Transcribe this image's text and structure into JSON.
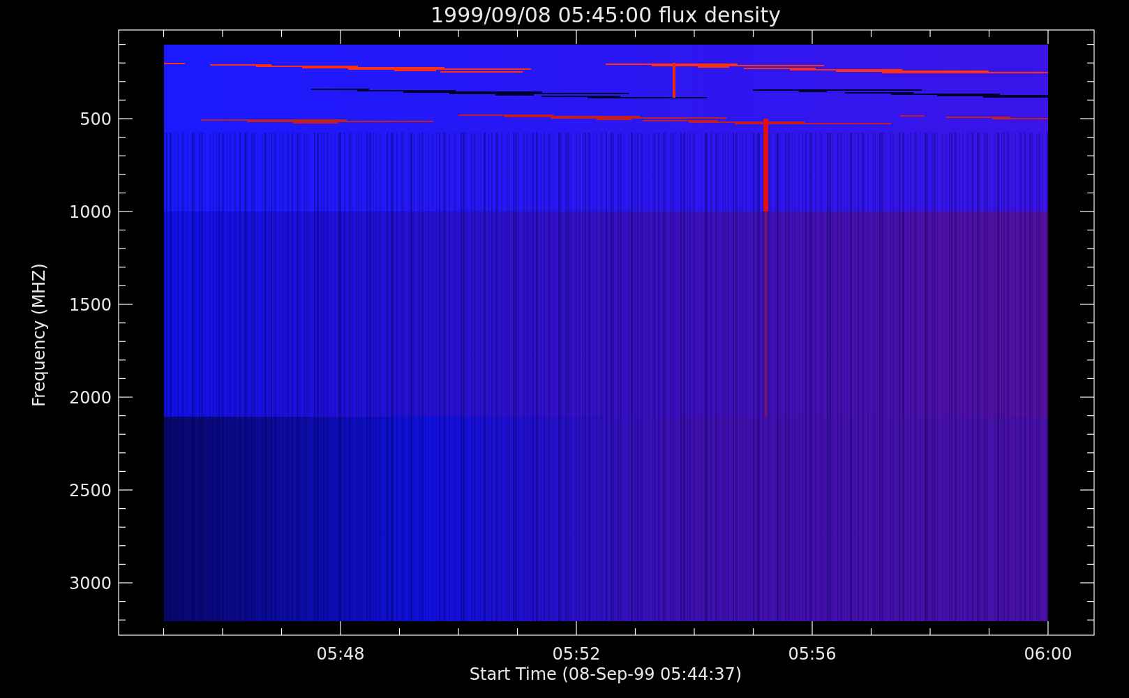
{
  "plot": {
    "title": "1999/09/08 05:45:00 flux density",
    "x_axis": {
      "label": "Start Time (08-Sep-99 05:44:37)",
      "ticks": [
        "05:48",
        "05:52",
        "05:56",
        "06:00"
      ]
    },
    "y_axis": {
      "label": "Frequency (MHZ)",
      "ticks": [
        "500",
        "1000",
        "1500",
        "2000",
        "2500",
        "3000"
      ]
    }
  }
}
